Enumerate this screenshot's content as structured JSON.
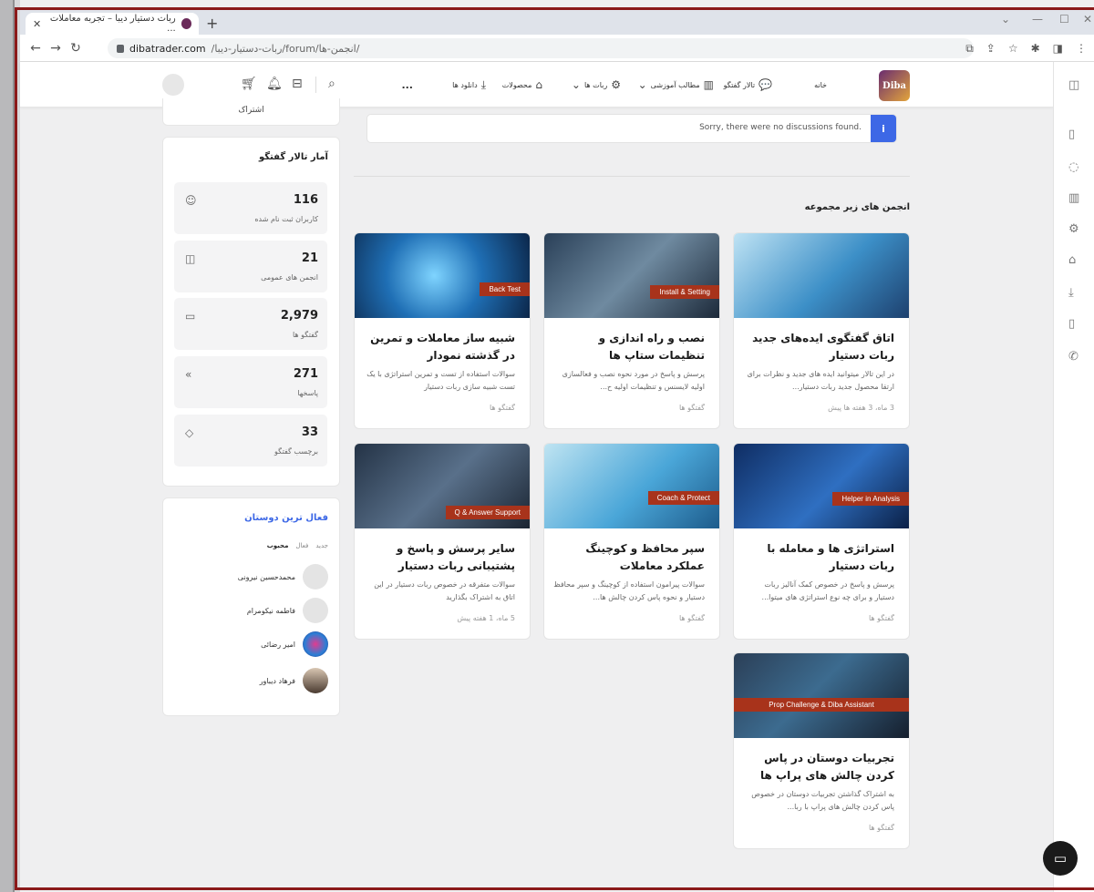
{
  "browser": {
    "tab_title": "ربات دستیار دیبا – تجربه معاملات ...",
    "url_host": "dibatrader.com",
    "url_path": "/ربات-دستیار-دیبا/forum/انجمن-ها/"
  },
  "header": {
    "logo_text": "Diba",
    "nav": [
      {
        "label": "خانه"
      },
      {
        "label": "تالار گفتگو"
      },
      {
        "label": "مطالب آموزشی"
      },
      {
        "label": "ربات ها"
      },
      {
        "label": "محصولات"
      },
      {
        "label": "دانلود ها"
      },
      {
        "label": "..."
      }
    ]
  },
  "sidebar": {
    "subscribe_label": "اشتراک",
    "stats_title": "آمار تالار گفتگو",
    "stats": [
      {
        "value": "116",
        "label": "کاربران ثبت نام شده",
        "icon": "users-icon"
      },
      {
        "value": "21",
        "label": "انجمن های عمومی",
        "icon": "forum-icon"
      },
      {
        "value": "2,979",
        "label": "گفتگو ها",
        "icon": "chat-icon"
      },
      {
        "value": "271",
        "label": "پاسخها",
        "icon": "reply-icon"
      },
      {
        "value": "33",
        "label": "برچسب گفتگو",
        "icon": "tag-icon"
      }
    ],
    "friends_title": "فعال ترین دوستان",
    "friends_tabs": [
      "جدید",
      "فعال",
      "محبوب"
    ],
    "friends": [
      {
        "name": "محمدحسین نیرونی"
      },
      {
        "name": "فاطمه نیکومرام"
      },
      {
        "name": "امیر رضائی"
      },
      {
        "name": "فرهاد دیباور"
      }
    ]
  },
  "main": {
    "notice": "Sorry, there were no discussions found.",
    "notice_icon": "i",
    "subforums_title": "انجمن های زیر مجموعه",
    "forums": [
      {
        "tag": "",
        "title": "اتاق گفتگوی ایده‌های جدید ربات دستیار",
        "desc": "در این تالار میتوانید ایده های جدید و نظرات برای ارتقا محصول جدید ربات دستیار...",
        "meta": "3 ماه، 3 هفته ها پیش"
      },
      {
        "tag": "Install & Setting",
        "title": "نصب و راه اندازی و تنظیمات ستاپ ها",
        "desc": "پرسش و پاسخ در مورد نحوه نصب و فعالسازی اولیه لایسنس و تنظیمات اولیه ح...",
        "meta": "گفتگو ها"
      },
      {
        "tag": "Back Test",
        "title": "شبیه ساز معاملات و تمرین در گذشته نمودار",
        "desc": "سوالات استفاده از تست و تمرین استراتژی با یک تست شبیه سازی ربات دستیار",
        "meta": "گفتگو ها"
      },
      {
        "tag": "Helper in Analysis",
        "title": "استراتژی ها و معامله با ربات دستیار",
        "desc": "پرسش و پاسخ در خصوص کمک آنالیز ربات دستیار و برای چه نوع استراتژی های میتوا...",
        "meta": "گفتگو ها"
      },
      {
        "tag": "Coach & Protect",
        "title": "سپر محافظ و کوچینگ عملکرد معاملات",
        "desc": "سوالات پیرامون استفاده از کوچینگ و سپر محافظ دستیار و نحوه پاس کردن چالش ها...",
        "meta": "گفتگو ها"
      },
      {
        "tag": "Q & Answer Support",
        "title": "سایر پرسش و پاسخ و پشتیبانی ربات دستیار",
        "desc": "سوالات متفرقه در خصوص ربات دستیار در این اتاق به اشتراک بگذارید",
        "meta": "5 ماه، 1 هفته پیش"
      },
      {
        "tag": "Prop Challenge & Diba Assistant",
        "title": "تجربیات دوستان در پاس کردن چالش های پراپ ها",
        "desc": "به اشتراک گذاشتن تجربیات دوستان در خصوص پاس کردن چالش های پراپ با ربا...",
        "meta": "گفتگو ها"
      }
    ]
  }
}
